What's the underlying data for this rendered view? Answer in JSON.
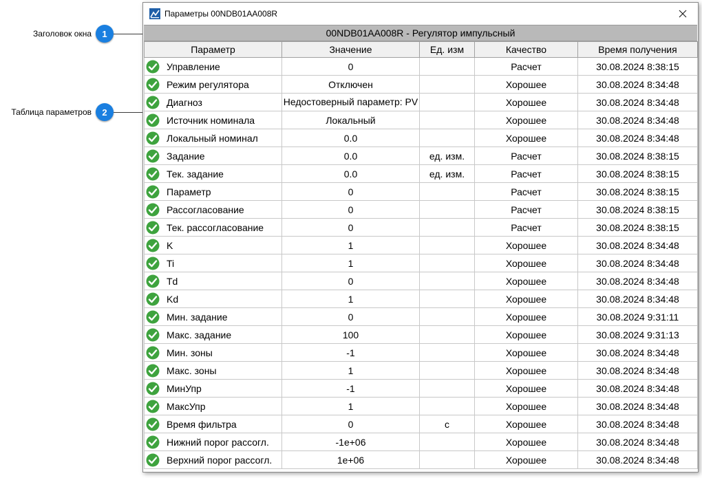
{
  "annotations": [
    {
      "label": "Заголовок окна",
      "number": "1"
    },
    {
      "label": "Таблица параметров",
      "number": "2"
    }
  ],
  "window": {
    "title": "Параметры 00NDB01AA008R",
    "caption": "00NDB01AA008R - Регулятор импульсный",
    "icons": {
      "app": "app-logo-icon",
      "close": "close-icon",
      "status": "check-circle-icon"
    },
    "colors": {
      "accent": "#1a7fe0",
      "check": "#3ea33e",
      "caption_bg": "#b9b9b9"
    }
  },
  "table": {
    "columns": [
      "Параметр",
      "Значение",
      "Ед. изм",
      "Качество",
      "Время получения"
    ],
    "rows": [
      {
        "name": "Управление",
        "value": "0",
        "unit": "",
        "quality": "Расчет",
        "time": "30.08.2024 8:38:15"
      },
      {
        "name": "Режим регулятора",
        "value": "Отключен",
        "unit": "",
        "quality": "Хорошее",
        "time": "30.08.2024 8:34:48"
      },
      {
        "name": "Диагноз",
        "value": "Недостоверный параметр: PV",
        "unit": "",
        "quality": "Хорошее",
        "time": "30.08.2024 8:34:48"
      },
      {
        "name": "Источник номинала",
        "value": "Локальный",
        "unit": "",
        "quality": "Хорошее",
        "time": "30.08.2024 8:34:48"
      },
      {
        "name": "Локальный номинал",
        "value": "0.0",
        "unit": "",
        "quality": "Хорошее",
        "time": "30.08.2024 8:34:48"
      },
      {
        "name": "Задание",
        "value": "0.0",
        "unit": "ед. изм.",
        "quality": "Расчет",
        "time": "30.08.2024 8:38:15"
      },
      {
        "name": "Тек. задание",
        "value": "0.0",
        "unit": "ед. изм.",
        "quality": "Расчет",
        "time": "30.08.2024 8:38:15"
      },
      {
        "name": "Параметр",
        "value": "0",
        "unit": "",
        "quality": "Расчет",
        "time": "30.08.2024 8:38:15"
      },
      {
        "name": "Рассогласование",
        "value": "0",
        "unit": "",
        "quality": "Расчет",
        "time": "30.08.2024 8:38:15"
      },
      {
        "name": "Тек. рассогласование",
        "value": "0",
        "unit": "",
        "quality": "Расчет",
        "time": "30.08.2024 8:38:15"
      },
      {
        "name": "K",
        "value": "1",
        "unit": "",
        "quality": "Хорошее",
        "time": "30.08.2024 8:34:48"
      },
      {
        "name": "Ti",
        "value": "1",
        "unit": "",
        "quality": "Хорошее",
        "time": "30.08.2024 8:34:48"
      },
      {
        "name": "Td",
        "value": "0",
        "unit": "",
        "quality": "Хорошее",
        "time": "30.08.2024 8:34:48"
      },
      {
        "name": "Kd",
        "value": "1",
        "unit": "",
        "quality": "Хорошее",
        "time": "30.08.2024 8:34:48"
      },
      {
        "name": "Мин. задание",
        "value": "0",
        "unit": "",
        "quality": "Хорошее",
        "time": "30.08.2024 9:31:11"
      },
      {
        "name": "Макс. задание",
        "value": "100",
        "unit": "",
        "quality": "Хорошее",
        "time": "30.08.2024 9:31:13"
      },
      {
        "name": "Мин. зоны",
        "value": "-1",
        "unit": "",
        "quality": "Хорошее",
        "time": "30.08.2024 8:34:48"
      },
      {
        "name": "Макс. зоны",
        "value": "1",
        "unit": "",
        "quality": "Хорошее",
        "time": "30.08.2024 8:34:48"
      },
      {
        "name": "МинУпр",
        "value": "-1",
        "unit": "",
        "quality": "Хорошее",
        "time": "30.08.2024 8:34:48"
      },
      {
        "name": "МаксУпр",
        "value": "1",
        "unit": "",
        "quality": "Хорошее",
        "time": "30.08.2024 8:34:48"
      },
      {
        "name": "Время фильтра",
        "value": "0",
        "unit": "с",
        "quality": "Хорошее",
        "time": "30.08.2024 8:34:48"
      },
      {
        "name": "Нижний порог рассогл.",
        "value": "-1e+06",
        "unit": "",
        "quality": "Хорошее",
        "time": "30.08.2024 8:34:48"
      },
      {
        "name": "Верхний порог рассогл.",
        "value": "1e+06",
        "unit": "",
        "quality": "Хорошее",
        "time": "30.08.2024 8:34:48"
      }
    ]
  }
}
